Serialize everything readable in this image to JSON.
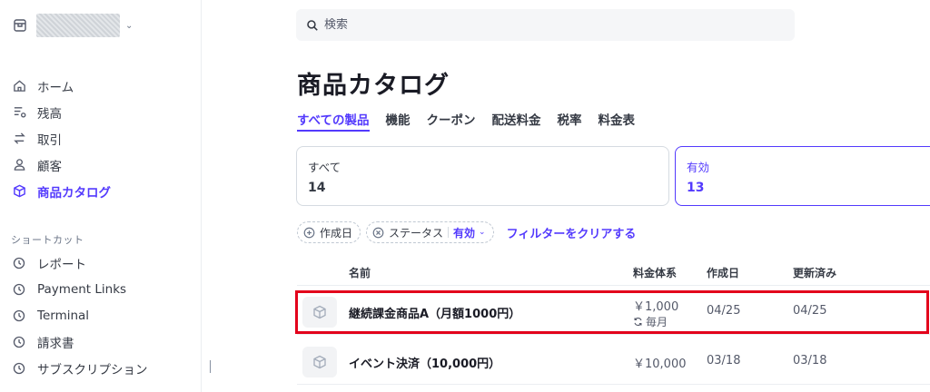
{
  "search": {
    "placeholder": "検索"
  },
  "sidebar": {
    "items": [
      {
        "label": "ホーム",
        "icon": "home-icon"
      },
      {
        "label": "残高",
        "icon": "balance-icon"
      },
      {
        "label": "取引",
        "icon": "transactions-icon"
      },
      {
        "label": "顧客",
        "icon": "customer-icon"
      },
      {
        "label": "商品カタログ",
        "icon": "product-icon",
        "active": true
      }
    ],
    "shortcuts_title": "ショートカット",
    "shortcuts": [
      {
        "label": "レポート",
        "icon": "clock-icon"
      },
      {
        "label": "Payment Links",
        "icon": "clock-icon"
      },
      {
        "label": "Terminal",
        "icon": "clock-icon"
      },
      {
        "label": "請求書",
        "icon": "clock-icon"
      },
      {
        "label": "サブスクリプション",
        "icon": "clock-icon"
      }
    ]
  },
  "page": {
    "title": "商品カタログ"
  },
  "tabs": [
    {
      "label": "すべての製品",
      "active": true
    },
    {
      "label": "機能"
    },
    {
      "label": "クーポン"
    },
    {
      "label": "配送料金"
    },
    {
      "label": "税率"
    },
    {
      "label": "料金表"
    }
  ],
  "summary_cards": [
    {
      "label": "すべて",
      "value": "14"
    },
    {
      "label": "有効",
      "value": "13",
      "active": true
    }
  ],
  "filters": {
    "created": "作成日",
    "status_label": "ステータス",
    "status_value": "有効",
    "clear": "フィルターをクリアする"
  },
  "table": {
    "headers": {
      "name": "名前",
      "pricing": "料金体系",
      "created": "作成日",
      "updated": "更新済み"
    },
    "rows": [
      {
        "name": "継続課金商品A（月額1000円）",
        "price": "￥1,000",
        "interval": "毎月",
        "created": "04/25",
        "updated": "04/25"
      },
      {
        "name": "イベント決済（10,000円）",
        "price": "￥10,000",
        "created": "03/18",
        "updated": "03/18"
      }
    ]
  },
  "colors": {
    "accent": "#533afd",
    "highlight": "#e3001b",
    "text": "#353a44"
  }
}
